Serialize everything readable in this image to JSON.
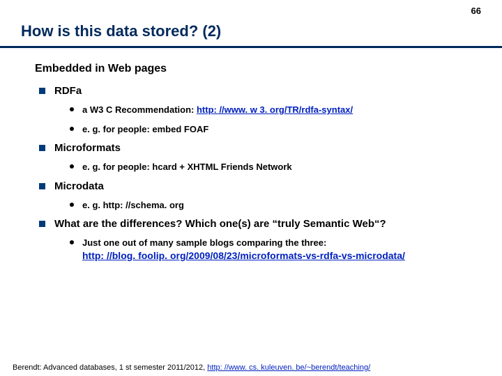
{
  "page_number": "66",
  "title": "How is this data stored? (2)",
  "section_heading": "Embedded in Web pages",
  "items": [
    {
      "label": "RDFa",
      "sub": [
        {
          "prefix": "a W3 C Recommendation: ",
          "link_text": "http: //www. w 3. org/TR/rdfa-syntax/"
        },
        {
          "text": "e. g. for people: embed FOAF"
        }
      ]
    },
    {
      "label": "Microformats",
      "sub": [
        {
          "text": "e. g. for people: hcard + XHTML Friends Network"
        }
      ]
    },
    {
      "label": "Microdata",
      "sub": [
        {
          "text": "e. g. http: //schema. org"
        }
      ]
    },
    {
      "label": "What are the differences? Which one(s) are “truly Semantic Web“?",
      "sub": [
        {
          "prefix": "Just one out of many sample blogs comparing the three: ",
          "link_text": "http: //blog. foolip. org/2009/08/23/microformats-vs-rdfa-vs-microdata/"
        }
      ]
    }
  ],
  "footer": {
    "prefix": "Berendt: Advanced databases, 1 st semester 2011/2012, ",
    "link_text": "http: //www. cs. kuleuven. be/~berendt/teaching/"
  }
}
